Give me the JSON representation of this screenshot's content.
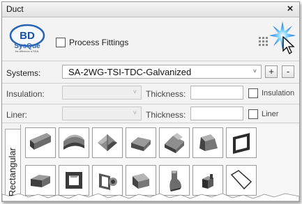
{
  "window": {
    "title": "Duct",
    "close_glyph": "×"
  },
  "logo": {
    "letters": "BD",
    "brand": "SysQue",
    "tagline": "the difference is REAL"
  },
  "process_fittings": {
    "label": "Process Fittings",
    "checked": false
  },
  "systems": {
    "label": "Systems:",
    "value": "SA-2WG-TSI-TDC-Galvanized",
    "add_label": "+",
    "remove_label": "-"
  },
  "insulation": {
    "label": "Insulation:",
    "value": "",
    "thickness_label": "Thickness:",
    "thickness_value": "",
    "toggle_label": "Insulation",
    "checked": false
  },
  "liner": {
    "label": "Liner:",
    "value": "",
    "thickness_label": "Thickness:",
    "thickness_value": "",
    "toggle_label": "Liner",
    "checked": false
  },
  "tabs": [
    {
      "label": "Rectangular",
      "active": true
    }
  ],
  "fittings": [
    {
      "name": "straight-duct-icon"
    },
    {
      "name": "elbow-icon"
    },
    {
      "name": "tee-icon"
    },
    {
      "name": "offset-icon"
    },
    {
      "name": "cross-icon"
    },
    {
      "name": "transition-icon"
    },
    {
      "name": "frame-icon"
    },
    {
      "name": "offset-transition-icon"
    },
    {
      "name": "square-collar-icon"
    },
    {
      "name": "damper-icon"
    },
    {
      "name": "tap-icon"
    },
    {
      "name": "shoe-tap-icon"
    },
    {
      "name": "end-cap-icon"
    },
    {
      "name": "access-panel-icon"
    }
  ]
}
